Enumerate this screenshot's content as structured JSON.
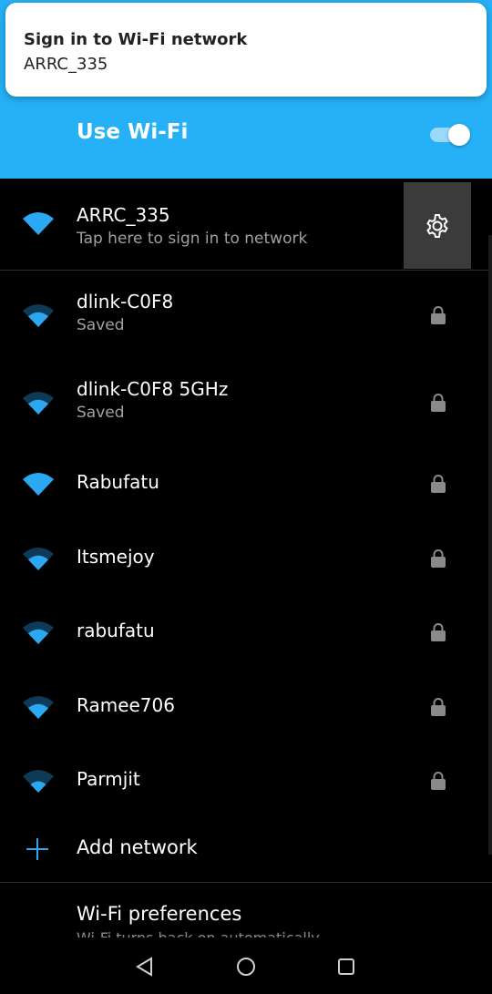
{
  "notification": {
    "title": "Sign in to Wi-Fi network",
    "subtitle": "ARRC_335"
  },
  "header": {
    "title": "Use Wi-Fi",
    "toggle_on": true,
    "accent_color": "#26b0f6"
  },
  "connected_network": {
    "name": "ARRC_335",
    "status": "Tap here to sign in to network",
    "icon": "wifi-full-icon",
    "settings_icon": "gear-icon"
  },
  "networks": [
    {
      "name": "dlink-C0F8",
      "status": "Saved",
      "signal": 2,
      "secured": true
    },
    {
      "name": "dlink-C0F8 5GHz",
      "status": "Saved",
      "signal": 2,
      "secured": true
    },
    {
      "name": "Rabufatu",
      "status": "",
      "signal": 4,
      "secured": true
    },
    {
      "name": "Itsmejoy",
      "status": "",
      "signal": 2,
      "secured": true
    },
    {
      "name": "rabufatu",
      "status": "",
      "signal": 2,
      "secured": true
    },
    {
      "name": "Ramee706",
      "status": "",
      "signal": 2,
      "secured": true
    },
    {
      "name": "Parmjit",
      "status": "",
      "signal": 1,
      "secured": true
    }
  ],
  "add_network": {
    "label": "Add network",
    "icon": "plus-icon"
  },
  "preferences": {
    "label": "Wi-Fi preferences",
    "subtitle": "Wi-Fi turns back on automatically"
  },
  "navbar": {
    "back_icon": "back-triangle-icon",
    "home_icon": "home-circle-icon",
    "recents_icon": "recents-square-icon"
  }
}
